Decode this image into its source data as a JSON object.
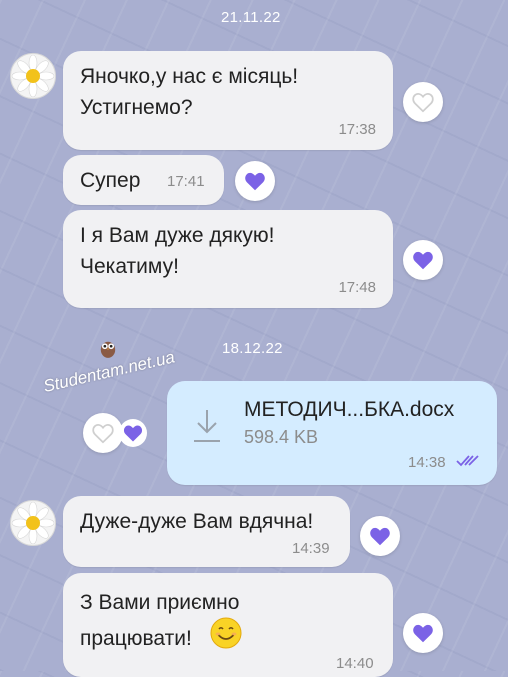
{
  "dates": {
    "first": "21.11.22",
    "second": "18.12.22"
  },
  "messages": [
    {
      "text": "Яночко,у нас є місяць!\nУстигнемо?",
      "time": "17:38",
      "liked": false
    },
    {
      "text": "Супер",
      "time": "17:41",
      "liked": true
    },
    {
      "text": "І я Вам дуже дякую!\nЧекатиму!",
      "time": "17:48",
      "liked": true
    },
    {
      "text": "Дуже-дуже Вам вдячна!",
      "time": "14:39",
      "liked": true
    },
    {
      "text": "З Вами приємно\nпрацювати!",
      "time": "14:40",
      "liked": true
    }
  ],
  "file": {
    "name": "МЕТОДИЧ...БКА.docx",
    "size": "598.4 KB",
    "time": "14:38",
    "status": "read"
  },
  "watermark": "Studentam.net.ua",
  "colors": {
    "heart": "#7b62e6",
    "incoming_bubble": "#f1f1f3",
    "outgoing_bubble": "#d4ecff",
    "read_ticks": "#7b62e6"
  },
  "icons": {
    "avatar": "daisy-avatar-icon",
    "like": "heart-icon",
    "download": "download-icon",
    "emoji": "smiling-face-icon",
    "read": "double-check-icon",
    "owl": "owl-icon"
  }
}
